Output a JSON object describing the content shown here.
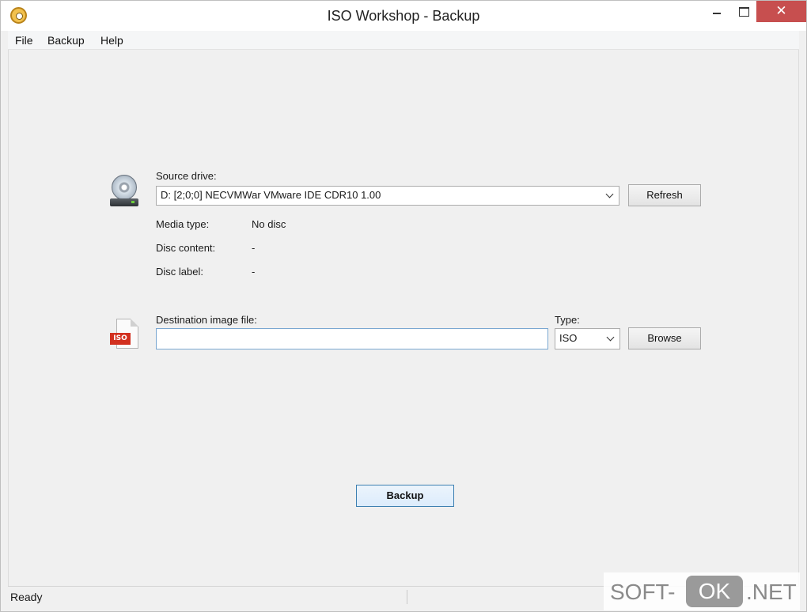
{
  "window": {
    "title": "ISO Workshop - Backup",
    "close_glyph": "✕"
  },
  "menu": [
    "File",
    "Backup",
    "Help"
  ],
  "source": {
    "label": "Source drive:",
    "selected_drive": "D:  [2;0;0] NECVMWar VMware IDE CDR10 1.00",
    "refresh_label": "Refresh",
    "icon": "optical-drive-icon"
  },
  "info": [
    {
      "label": "Media type:",
      "value": "No disc"
    },
    {
      "label": "Disc content:",
      "value": "-"
    },
    {
      "label": "Disc label:",
      "value": "-"
    }
  ],
  "destination": {
    "label": "Destination image file:",
    "value": "",
    "type_label": "Type:",
    "type_value": "ISO",
    "browse_label": "Browse",
    "icon": "iso-file-icon",
    "icon_tag": "ISO"
  },
  "actions": {
    "backup_label": "Backup"
  },
  "status": {
    "text": "Ready"
  },
  "watermark": {
    "left": "SOFT-",
    "box": "OK",
    "right": ".NET"
  },
  "colors": {
    "close_button": "#c74f4f",
    "iso_tag": "#d2301f",
    "primary_border": "#3c7fb1"
  }
}
